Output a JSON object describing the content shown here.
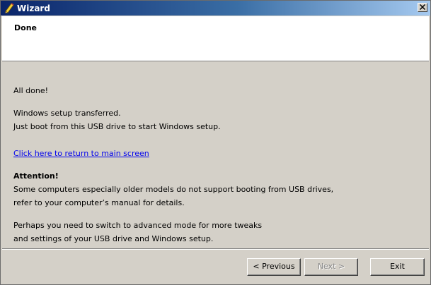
{
  "window": {
    "title": "Wizard",
    "icon": "pencil-icon",
    "close_icon": "close-icon"
  },
  "header": {
    "title": "Done"
  },
  "content": {
    "all_done": "All done!",
    "setup_transferred": "Windows setup transferred.",
    "boot_instruction": "Just boot from this USB drive to start Windows setup.",
    "return_link": "Click here to return to main screen",
    "attention_heading": "Attention!",
    "attention_line1": "Some computers especially older models do not support booting from USB drives,",
    "attention_line2": "refer to your computer’s manual for details.",
    "advanced_line1": "Perhaps you need to switch to advanced mode for more tweaks",
    "advanced_line2": "and settings of your USB drive and Windows setup."
  },
  "buttons": {
    "previous": "< Previous",
    "next": "Next >",
    "exit": "Exit",
    "next_enabled": false
  },
  "colors": {
    "title_gradient_start": "#0a246a",
    "title_gradient_end": "#a6caf0",
    "face": "#d4d0c8",
    "link": "#0000ee"
  }
}
